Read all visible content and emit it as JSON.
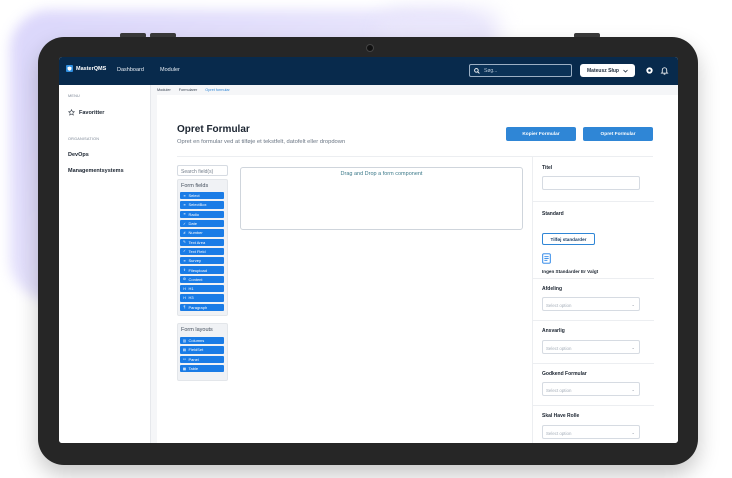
{
  "app": {
    "brand": "MasterQMS"
  },
  "topnav": {
    "dashboard": "Dashboard",
    "modules": "Moduler"
  },
  "search": {
    "placeholder": "Søg..."
  },
  "user": {
    "name": "Mateusz Słup"
  },
  "sidebar": {
    "menu_heading": "MENU",
    "favorites": "Favoritter",
    "org_heading": "ORGANISATION",
    "orgs": [
      "DevOps",
      "Managementsystems"
    ]
  },
  "breadcrumb": [
    "Moduler",
    "Formularer",
    "Opret formular"
  ],
  "page": {
    "title": "Opret Formular",
    "subtitle": "Opret en formular ved at tilføje et tekstfelt, datofelt eller dropdown",
    "copy_button": "Kopier Formular",
    "create_button": "Opret Formular"
  },
  "palette": {
    "search_placeholder": "Search field(s)",
    "form_fields_title": "Form fields",
    "form_fields": [
      {
        "label": "Select",
        "icon": "list-icon"
      },
      {
        "label": "SelectBox",
        "icon": "list-icon"
      },
      {
        "label": "Radio",
        "icon": "list-icon"
      },
      {
        "label": "Date",
        "icon": "check-icon"
      },
      {
        "label": "Number",
        "icon": "number-icon"
      },
      {
        "label": "Text Area",
        "icon": "pencil-icon"
      },
      {
        "label": "Text Field",
        "icon": "check-icon"
      },
      {
        "label": "Survey",
        "icon": "list-icon"
      },
      {
        "label": "Fileupload",
        "icon": "upload-icon"
      },
      {
        "label": "Content",
        "icon": "gear-icon"
      },
      {
        "label": "H1",
        "icon": "heading-icon"
      },
      {
        "label": "H3",
        "icon": "heading-icon"
      },
      {
        "label": "Paragraph",
        "icon": "paragraph-icon"
      }
    ],
    "form_layouts_title": "Form layouts",
    "form_layouts": [
      {
        "label": "Columns",
        "icon": "columns-icon"
      },
      {
        "label": "FieldSet",
        "icon": "fieldset-icon"
      },
      {
        "label": "Panel",
        "icon": "panel-icon"
      },
      {
        "label": "Table",
        "icon": "table-icon"
      }
    ]
  },
  "dropzone": {
    "text": "Drag and Drop a form component"
  },
  "right": {
    "title_label": "Titel",
    "standard_label": "Standard",
    "add_standards_button": "Tilføj standarder",
    "no_standards": "Ingen Standarder Er Valgt",
    "department_label": "Afdeling",
    "responsible_label": "Ansvarlig",
    "approve_label": "Godkend Formular",
    "role_label": "Skal Have Rolle",
    "select_placeholder": "Select option"
  },
  "colors": {
    "navbar": "#082a4c",
    "accent": "#2f86d6",
    "component": "#1a7ce6"
  }
}
